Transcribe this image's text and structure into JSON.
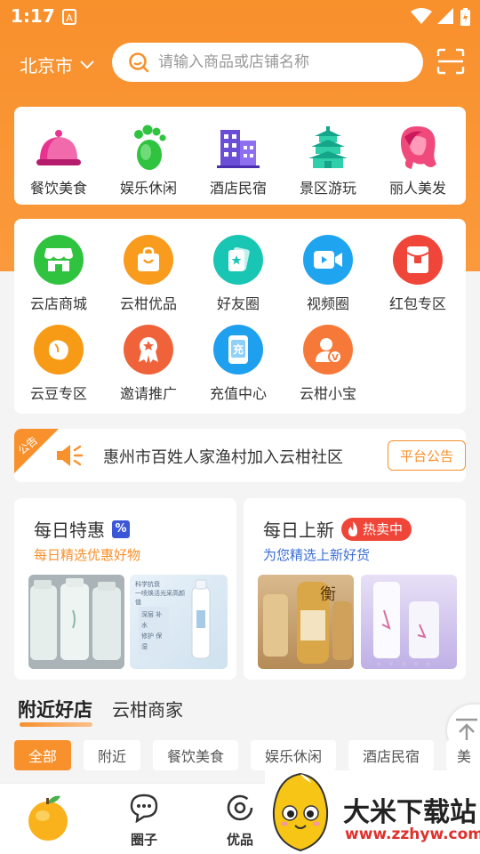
{
  "status_bar": {
    "time": "1:17"
  },
  "header": {
    "city": "北京市",
    "search_placeholder": "请输入商品或店铺名称"
  },
  "categories": [
    {
      "label": "餐饮美食",
      "icon": "food-cloche-icon"
    },
    {
      "label": "娱乐休闲",
      "icon": "footprint-icon"
    },
    {
      "label": "酒店民宿",
      "icon": "hotel-building-icon"
    },
    {
      "label": "景区游玩",
      "icon": "pagoda-icon"
    },
    {
      "label": "丽人美发",
      "icon": "hair-salon-icon"
    }
  ],
  "services": [
    {
      "label": "云店商城",
      "icon": "store-icon",
      "color": "#2fc33f"
    },
    {
      "label": "云柑优品",
      "icon": "shopping-bag-icon",
      "color": "#f99b1c"
    },
    {
      "label": "好友圈",
      "icon": "friends-card-icon",
      "color": "#19c6b4"
    },
    {
      "label": "视频圈",
      "icon": "video-camera-icon",
      "color": "#1fa4f0"
    },
    {
      "label": "红包专区",
      "icon": "red-envelope-icon",
      "color": "#f0463a"
    },
    {
      "label": "云豆专区",
      "icon": "bean-icon",
      "color": "#f79a16"
    },
    {
      "label": "邀请推广",
      "icon": "invite-badge-icon",
      "color": "#f0623a"
    },
    {
      "label": "充值中心",
      "icon": "recharge-phone-icon",
      "color": "#1ea0ef"
    },
    {
      "label": "云柑小宝",
      "icon": "assistant-avatar-icon",
      "color": "#f7793a"
    }
  ],
  "notice": {
    "tag": "公告",
    "text": "惠州市百姓人家渔村加入云柑社区",
    "button": "平台公告"
  },
  "promos": [
    {
      "title": "每日特惠",
      "badge": "%",
      "subtitle": "每日精选优惠好物",
      "subtitle_color": "#f8902c"
    },
    {
      "title": "每日上新",
      "badge": "热卖中",
      "subtitle": "为您精选上新好货",
      "subtitle_color": "#3b6fd6"
    }
  ],
  "product_texts": {
    "p2": "科学抗衰\n一喷焕活光采高颜值",
    "p2b": "深层 补水\n修护 保湿",
    "p3": "衡"
  },
  "section_tabs": [
    {
      "label": "附近好店",
      "active": true
    },
    {
      "label": "云柑商家",
      "active": false
    }
  ],
  "filters": [
    {
      "label": "全部",
      "active": true
    },
    {
      "label": "附近"
    },
    {
      "label": "餐饮美食"
    },
    {
      "label": "娱乐休闲"
    },
    {
      "label": "酒店民宿"
    },
    {
      "label": "美"
    }
  ],
  "tabbar": [
    {
      "label": "",
      "icon": "orange-home-icon"
    },
    {
      "label": "圈子",
      "icon": "chat-bubble-icon"
    },
    {
      "label": "优品",
      "icon": "target-icon"
    }
  ],
  "watermark": {
    "title": "大米下载站",
    "url": "www.zzhyw.com"
  },
  "colors": {
    "accent": "#f8902c",
    "hot": "#f0463a"
  }
}
